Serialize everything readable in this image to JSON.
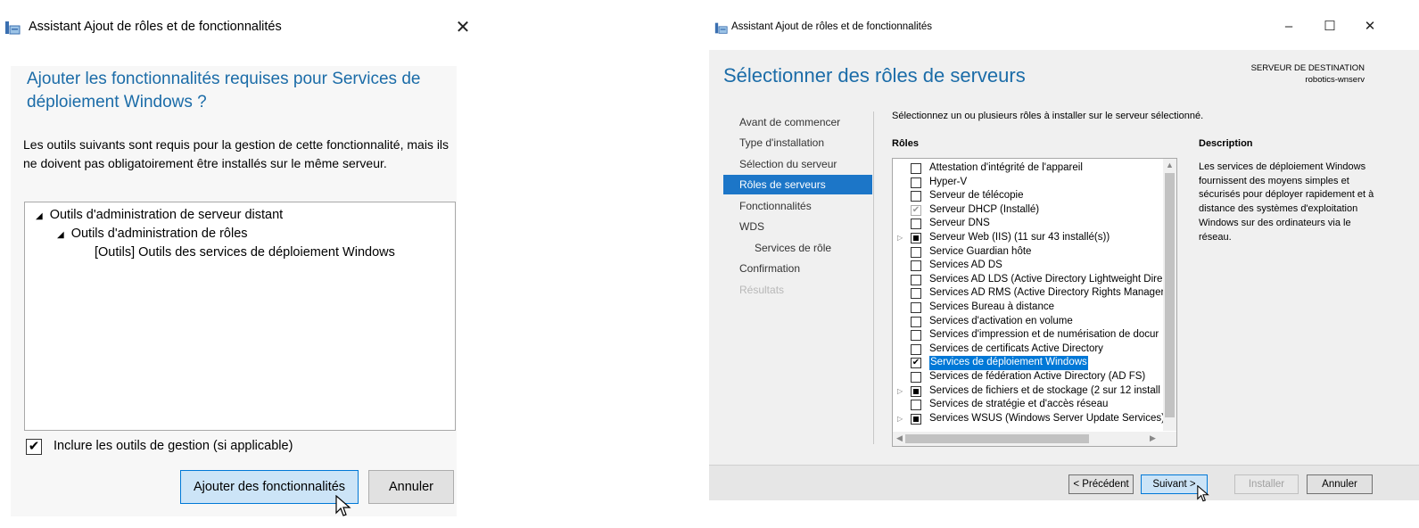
{
  "left_dialog": {
    "title": "Assistant Ajout de rôles et de fonctionnalités",
    "heading": "Ajouter les fonctionnalités requises pour Services de déploiement Windows ?",
    "description": "Les outils suivants sont requis pour la gestion de cette fonctionnalité, mais ils ne doivent pas obligatoirement être installés sur le même serveur.",
    "tree": [
      "Outils d'administration de serveur distant",
      "Outils d'administration de rôles",
      "[Outils] Outils des services de déploiement Windows"
    ],
    "include_tools_label": "Inclure les outils de gestion (si applicable)",
    "include_tools_checked": true,
    "add_button": "Ajouter des fonctionnalités",
    "cancel_button": "Annuler"
  },
  "right_wizard": {
    "title": "Assistant Ajout de rôles et de fonctionnalités",
    "heading": "Sélectionner des rôles de serveurs",
    "destination_label": "SERVEUR DE DESTINATION",
    "destination_server": "robotics-wnserv",
    "nav": [
      "Avant de commencer",
      "Type d'installation",
      "Sélection du serveur",
      "Rôles de serveurs",
      "Fonctionnalités",
      "WDS",
      "Services de rôle",
      "Confirmation",
      "Résultats"
    ],
    "instruction": "Sélectionnez un ou plusieurs rôles à installer sur le serveur sélectionné.",
    "roles_header": "Rôles",
    "description_header": "Description",
    "description": "Les services de déploiement Windows fournissent des moyens simples et sécurisés pour déployer rapidement et à distance des systèmes d'exploitation Windows sur des ordinateurs via le réseau.",
    "roles": [
      "Attestation d'intégrité de l'appareil",
      "Hyper-V",
      "Serveur de télécopie",
      "Serveur DHCP (Installé)",
      "Serveur DNS",
      "Serveur Web (IIS) (11 sur 43 installé(s))",
      "Service Guardian hôte",
      "Services AD DS",
      "Services AD LDS (Active Directory Lightweight Dire",
      "Services AD RMS (Active Directory Rights Manager",
      "Services Bureau à distance",
      "Services d'activation en volume",
      "Services d'impression et de numérisation de docur",
      "Services de certificats Active Directory",
      "Services de déploiement Windows",
      "Services de fédération Active Directory (AD FS)",
      "Services de fichiers et de stockage (2 sur 12 install",
      "Services de stratégie et d'accès réseau",
      "Services WSUS (Windows Server Update Services)"
    ],
    "buttons": {
      "previous": "< Précédent",
      "next": "Suivant >",
      "install": "Installer",
      "cancel": "Annuler"
    }
  },
  "colors": {
    "accent_heading": "#1b6ca8",
    "selection": "#0078d7",
    "nav_active": "#1c76c8",
    "primary_button": "#cce4f7"
  }
}
